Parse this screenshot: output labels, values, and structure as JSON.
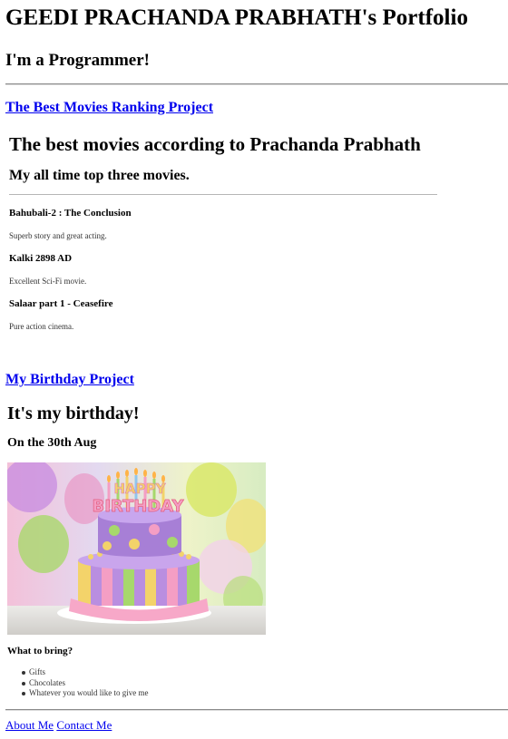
{
  "header": {
    "title": "GEEDI PRACHANDA PRABHATH's Portfolio",
    "subtitle": "I'm a Programmer!"
  },
  "movies_project": {
    "link_label": "The Best Movies Ranking Project",
    "title": "The best movies according to Prachanda Prabhath",
    "subtitle": "My all time top three movies.",
    "items": [
      {
        "title": "Bahubali-2 : The Conclusion",
        "desc": "Superb story and great acting."
      },
      {
        "title": "Kalki 2898 AD",
        "desc": "Excellent Sci-Fi movie."
      },
      {
        "title": "Salaar part 1 - Ceasefire",
        "desc": "Pure action cinema."
      }
    ]
  },
  "birthday_project": {
    "link_label": "My Birthday Project",
    "title": "It's my birthday!",
    "subtitle": "On the 30th Aug",
    "cake_text": "HAPPY BIRTHDAY",
    "bring_heading": "What to bring?",
    "bring_items": [
      "Gifts",
      "Chocolates",
      "Whatever you would like to give me"
    ]
  },
  "footer": {
    "about_label": "About Me",
    "contact_label": "Contact Me"
  },
  "colors": {
    "link": "#0000ee",
    "cake_purple": "#9b72c9",
    "cake_pink": "#f39ac0"
  }
}
